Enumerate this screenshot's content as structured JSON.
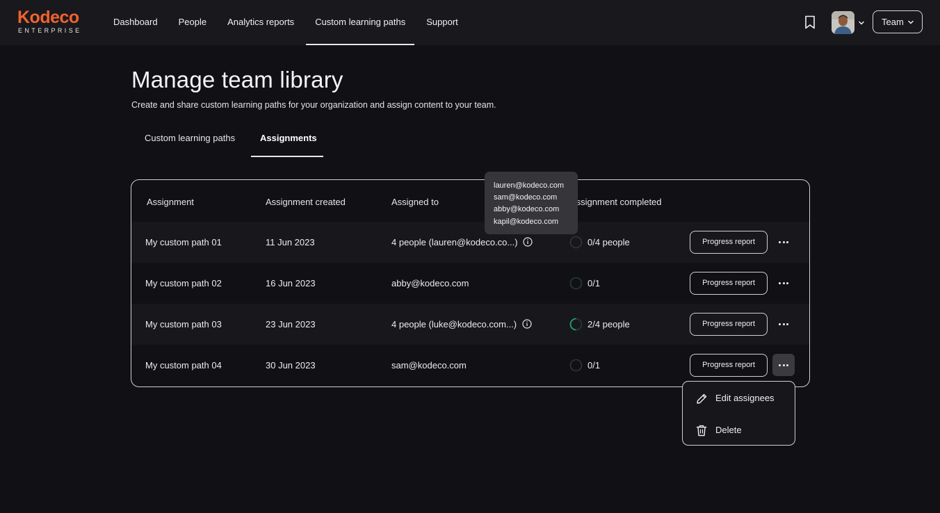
{
  "brand": {
    "name": "Kodeco",
    "sub": "ENTERPRISE",
    "color": "#f0622f"
  },
  "nav": {
    "items": [
      {
        "label": "Dashboard"
      },
      {
        "label": "People"
      },
      {
        "label": "Analytics reports"
      },
      {
        "label": "Custom learning paths",
        "active": true
      },
      {
        "label": "Support"
      }
    ],
    "team_label": "Team"
  },
  "header": {
    "title": "Manage team library",
    "subtitle": "Create and share custom learning paths for your organization and  assign content to your team."
  },
  "tabs": [
    {
      "label": "Custom learning paths"
    },
    {
      "label": "Assignments",
      "active": true
    }
  ],
  "table": {
    "headers": [
      "Assignment",
      "Assignment created",
      "Assigned to",
      "Assignment completed"
    ],
    "progress_label": "Progress report",
    "rows": [
      {
        "name": "My custom path 01",
        "created": "11 Jun 2023",
        "assigned": "4 people (lauren@kodeco.co...)",
        "has_info": true,
        "completed": "0/4 people",
        "progress": 0
      },
      {
        "name": "My custom path 02",
        "created": "16 Jun 2023",
        "assigned": "abby@kodeco.com",
        "has_info": false,
        "completed": "0/1",
        "progress": 0
      },
      {
        "name": "My custom path 03",
        "created": "23 Jun 2023",
        "assigned": "4 people (luke@kodeco.com...)",
        "has_info": true,
        "completed": "2/4 people",
        "progress": 0.5
      },
      {
        "name": "My custom path 04",
        "created": "30 Jun 2023",
        "assigned": "sam@kodeco.com",
        "has_info": false,
        "completed": "0/1",
        "progress": 0
      }
    ]
  },
  "tooltip": {
    "emails": [
      "lauren@kodeco.com",
      "sam@kodeco.com",
      "abby@kodeco.com",
      "kapil@kodeco.com"
    ]
  },
  "menu": {
    "edit_label": "Edit assignees",
    "delete_label": "Delete"
  },
  "colors": {
    "progress": "#1fa36b",
    "ring_track": "#2a3a33"
  }
}
